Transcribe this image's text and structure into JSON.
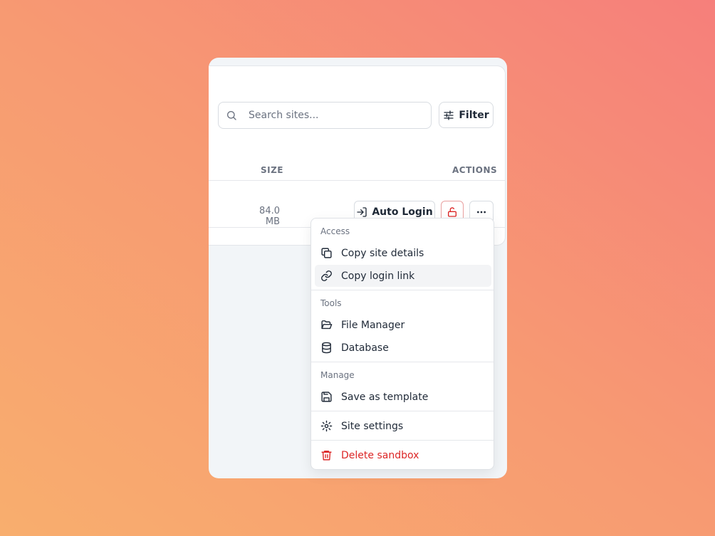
{
  "search": {
    "placeholder": "Search sites..."
  },
  "filter": {
    "label": "Filter"
  },
  "table": {
    "columns": {
      "size": "SIZE",
      "actions": "ACTIONS"
    },
    "rows": [
      {
        "size": "84.0 MB",
        "auto_login_label": "Auto Login"
      }
    ]
  },
  "menu": {
    "groups": [
      {
        "label": "Access",
        "items": [
          {
            "label": "Copy site details",
            "icon": "copy-icon"
          },
          {
            "label": "Copy login link",
            "icon": "link-icon"
          }
        ]
      },
      {
        "label": "Tools",
        "items": [
          {
            "label": "File Manager",
            "icon": "folder-open-icon"
          },
          {
            "label": "Database",
            "icon": "database-icon"
          }
        ]
      },
      {
        "label": "Manage",
        "items": [
          {
            "label": "Save as template",
            "icon": "save-icon"
          }
        ]
      }
    ],
    "settings": {
      "label": "Site settings",
      "icon": "gear-icon"
    },
    "delete": {
      "label": "Delete sandbox",
      "icon": "trash-icon"
    }
  },
  "colors": {
    "danger": "#dc2626",
    "text": "#1f2937",
    "muted": "#6b7280",
    "background_start": "#f8ae6e",
    "background_end": "#f67f7b"
  }
}
